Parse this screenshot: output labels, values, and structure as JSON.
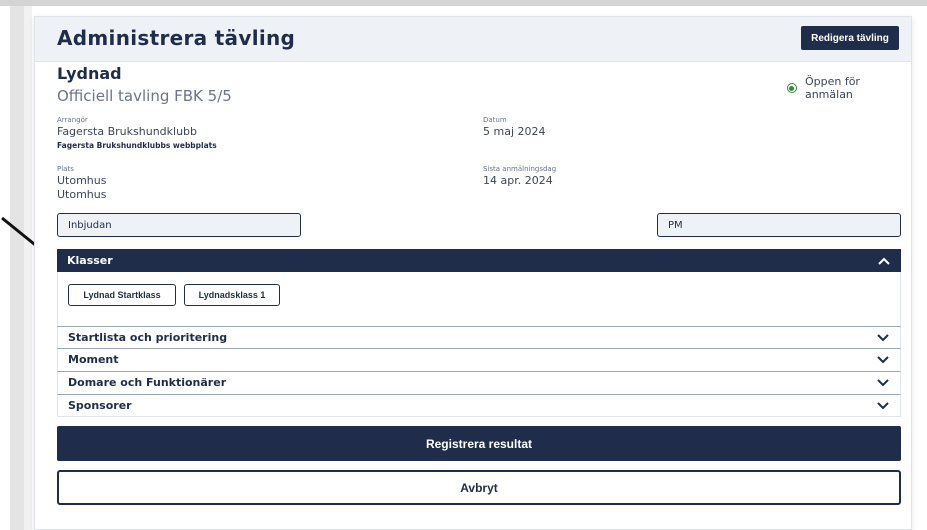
{
  "header": {
    "title": "Administrera tävling",
    "edit_button": "Redigera tävling"
  },
  "competition": {
    "name": "Lydnad",
    "subtitle": "Officiell tavling FBK 5/5",
    "status": "Öppen för anmälan",
    "status_color": "#2e8b3a"
  },
  "details": {
    "organizer_label": "Arrangör",
    "organizer": "Fagersta Brukshundklubb",
    "organizer_link": "Fagersta Brukshundklubbs webbplats",
    "date_label": "Datum",
    "date": "5 maj 2024",
    "place_label": "Plats",
    "place_line1": "Utomhus",
    "place_line2": "Utomhus",
    "deadline_label": "Sista anmälningsdag",
    "deadline": "14 apr. 2024"
  },
  "documents": {
    "invitation": "Inbjudan",
    "pm": "PM"
  },
  "accordion": {
    "open_section": {
      "label": "Klasser",
      "classes": [
        "Lydnad Startklass",
        "Lydnadsklass 1"
      ]
    },
    "sections": [
      {
        "label": "Startlista och prioritering"
      },
      {
        "label": "Moment"
      },
      {
        "label": "Domare och Funktionärer"
      },
      {
        "label": "Sponsorer"
      }
    ]
  },
  "actions": {
    "register": "Registrera resultat",
    "cancel": "Avbryt"
  },
  "colors": {
    "primary": "#1f2d4a",
    "header_bg": "#eef2f7"
  },
  "icons": [
    "chevron-up-icon",
    "chevron-down-icon",
    "status-dot-icon",
    "pointer-arrow-icon"
  ]
}
